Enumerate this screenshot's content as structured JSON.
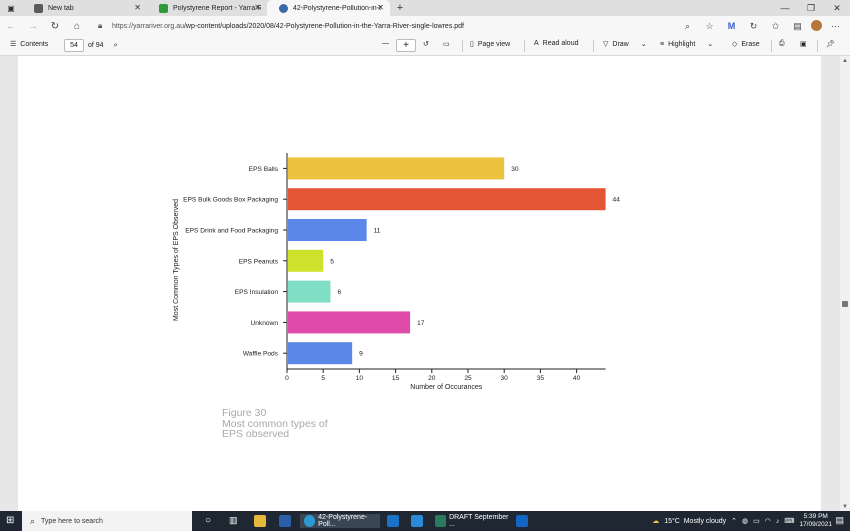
{
  "browser": {
    "tabs": [
      {
        "label": "New tab",
        "icon": "newtab-icon",
        "color": "#5b5b5b",
        "active": false
      },
      {
        "label": "Polystyrene Report - Yarra Riveri",
        "icon": "site-icon",
        "color": "#2e9a3d",
        "active": false
      },
      {
        "label": "42-Polystyrene-Pollution-in-the-",
        "icon": "wordpress-icon",
        "color": "#3a6aa8",
        "active": true
      }
    ],
    "url_host": "https://yarrariver.org.au",
    "url_path": "/wp-content/uploads/2020/08/42-Polystyrene-Pollution-in-the-Yarra-River-single-lowres.pdf"
  },
  "pdf_toolbar": {
    "contents_label": "Contents",
    "page_number": "54",
    "page_total": "of 94",
    "page_view_label": "Page view",
    "read_aloud_label": "Read aloud",
    "draw_label": "Draw",
    "highlight_label": "Highlight",
    "erase_label": "Erase"
  },
  "chart_data": {
    "type": "bar",
    "orientation": "horizontal",
    "categories": [
      "EPS Balls",
      "EPS Bulk Goods Box Packaging",
      "EPS Drink and Food Packaging",
      "EPS Peanuts",
      "EPS Insulation",
      "Unknown",
      "Waffle Pods"
    ],
    "values": [
      30,
      44,
      11,
      5,
      6,
      17,
      9
    ],
    "colors": [
      "#ecc33d",
      "#e35534",
      "#5a87e8",
      "#cde12d",
      "#7fdec4",
      "#de4ba9",
      "#5a87e8"
    ],
    "xlabel": "Number of Occurances",
    "ylabel": "Most Common Types of EPS Observed",
    "xticks": [
      0,
      5,
      10,
      15,
      20,
      25,
      30,
      35,
      40
    ],
    "xlim": [
      0,
      44
    ],
    "grid": false
  },
  "figure": {
    "number": "Figure 30",
    "caption_line1": "Most common types of",
    "caption_line2": "EPS observed"
  },
  "taskbar": {
    "search_placeholder": "Type here to search",
    "edge_task_label": "42-Polystyrene-Poll...",
    "word_task_label": "DRAFT September ...",
    "weather": "15°C  Mostly cloudy",
    "time": "5:39 PM",
    "date": "17/09/2021"
  }
}
